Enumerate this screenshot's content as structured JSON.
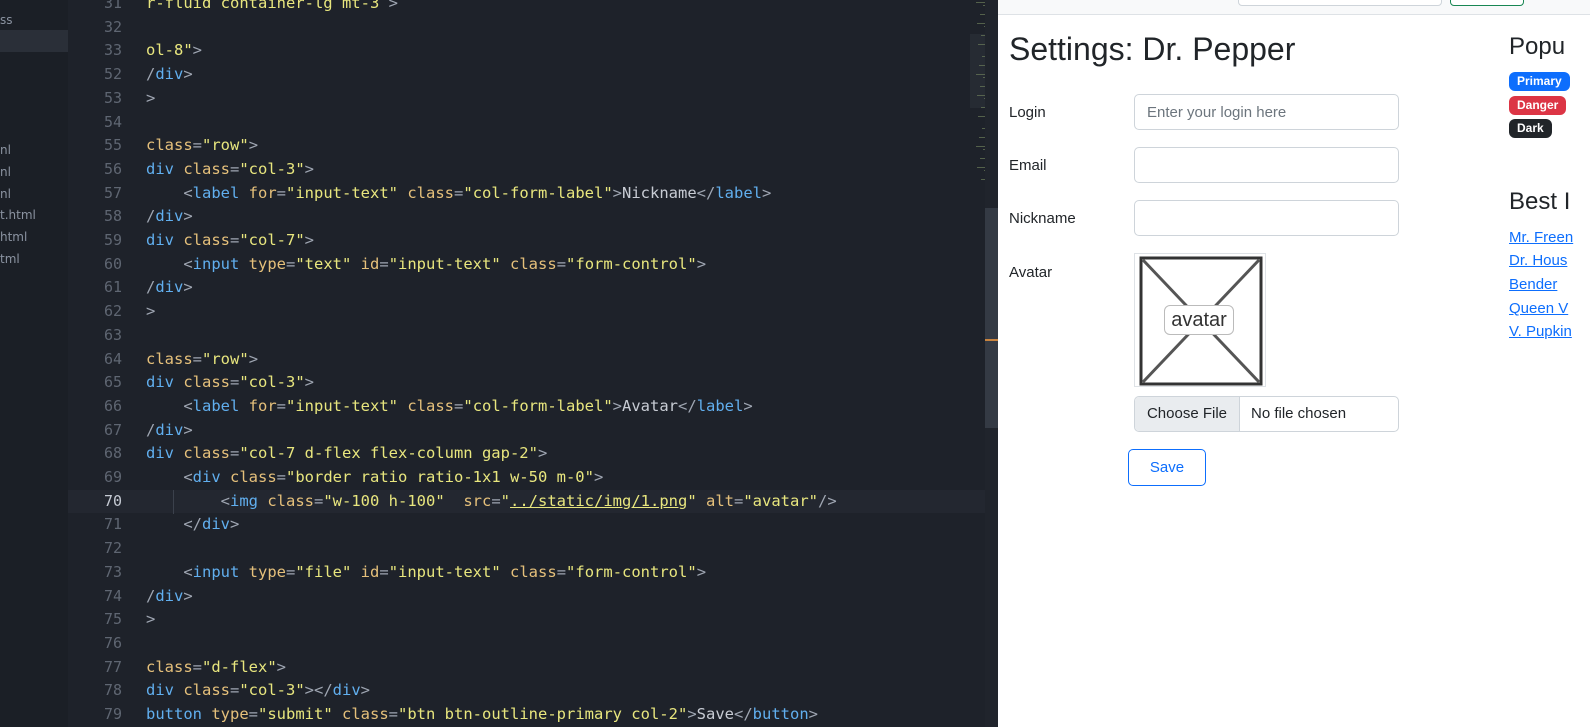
{
  "file_tree": {
    "items": [
      {
        "label": "ss"
      },
      {
        "label": "nl"
      },
      {
        "label": "nl"
      },
      {
        "label": "nl"
      },
      {
        "label": "t.html"
      },
      {
        "label": "html"
      },
      {
        "label": "tml"
      }
    ]
  },
  "editor": {
    "lines": [
      {
        "num": "31",
        "tokens": [
          {
            "t": "str",
            "v": "r-fluid container-lg mt-3"
          },
          {
            "t": "punct",
            "v": " >"
          }
        ]
      },
      {
        "num": "32",
        "tokens": []
      },
      {
        "num": "33",
        "tokens": [
          {
            "t": "str",
            "v": "ol-8\""
          },
          {
            "t": "punct",
            "v": ">"
          }
        ]
      },
      {
        "num": "52",
        "tokens": [
          {
            "t": "punct",
            "v": "/"
          },
          {
            "t": "tag",
            "v": "div"
          },
          {
            "t": "punct",
            "v": ">"
          }
        ]
      },
      {
        "num": "53",
        "tokens": [
          {
            "t": "punct",
            "v": ">"
          }
        ]
      },
      {
        "num": "54",
        "tokens": []
      },
      {
        "num": "55",
        "tokens": [
          {
            "t": "attr",
            "v": "class"
          },
          {
            "t": "punct",
            "v": "="
          },
          {
            "t": "str",
            "v": "\"row\""
          },
          {
            "t": "punct",
            "v": ">"
          }
        ]
      },
      {
        "num": "56",
        "tokens": [
          {
            "t": "tag",
            "v": "div "
          },
          {
            "t": "attr",
            "v": "class"
          },
          {
            "t": "punct",
            "v": "="
          },
          {
            "t": "str",
            "v": "\"col-3\""
          },
          {
            "t": "punct",
            "v": ">"
          }
        ]
      },
      {
        "num": "57",
        "tokens": [
          {
            "t": "text",
            "v": "    "
          },
          {
            "t": "punct",
            "v": "<"
          },
          {
            "t": "tag",
            "v": "label "
          },
          {
            "t": "attr",
            "v": "for"
          },
          {
            "t": "punct",
            "v": "="
          },
          {
            "t": "str",
            "v": "\"input-text\" "
          },
          {
            "t": "attr",
            "v": "class"
          },
          {
            "t": "punct",
            "v": "="
          },
          {
            "t": "str",
            "v": "\"col-form-label\""
          },
          {
            "t": "punct",
            "v": ">"
          },
          {
            "t": "text",
            "v": "Nickname"
          },
          {
            "t": "punct",
            "v": "</"
          },
          {
            "t": "tag",
            "v": "label"
          },
          {
            "t": "punct",
            "v": ">"
          }
        ]
      },
      {
        "num": "58",
        "tokens": [
          {
            "t": "punct",
            "v": "/"
          },
          {
            "t": "tag",
            "v": "div"
          },
          {
            "t": "punct",
            "v": ">"
          }
        ]
      },
      {
        "num": "59",
        "tokens": [
          {
            "t": "tag",
            "v": "div "
          },
          {
            "t": "attr",
            "v": "class"
          },
          {
            "t": "punct",
            "v": "="
          },
          {
            "t": "str",
            "v": "\"col-7\""
          },
          {
            "t": "punct",
            "v": ">"
          }
        ]
      },
      {
        "num": "60",
        "tokens": [
          {
            "t": "text",
            "v": "    "
          },
          {
            "t": "punct",
            "v": "<"
          },
          {
            "t": "tag",
            "v": "input "
          },
          {
            "t": "attr",
            "v": "type"
          },
          {
            "t": "punct",
            "v": "="
          },
          {
            "t": "str",
            "v": "\"text\" "
          },
          {
            "t": "attr",
            "v": "id"
          },
          {
            "t": "punct",
            "v": "="
          },
          {
            "t": "str",
            "v": "\"input-text\" "
          },
          {
            "t": "attr",
            "v": "class"
          },
          {
            "t": "punct",
            "v": "="
          },
          {
            "t": "str",
            "v": "\"form-control\""
          },
          {
            "t": "punct",
            "v": ">"
          }
        ]
      },
      {
        "num": "61",
        "tokens": [
          {
            "t": "punct",
            "v": "/"
          },
          {
            "t": "tag",
            "v": "div"
          },
          {
            "t": "punct",
            "v": ">"
          }
        ]
      },
      {
        "num": "62",
        "tokens": [
          {
            "t": "punct",
            "v": ">"
          }
        ]
      },
      {
        "num": "63",
        "tokens": []
      },
      {
        "num": "64",
        "tokens": [
          {
            "t": "attr",
            "v": "class"
          },
          {
            "t": "punct",
            "v": "="
          },
          {
            "t": "str",
            "v": "\"row\""
          },
          {
            "t": "punct",
            "v": ">"
          }
        ]
      },
      {
        "num": "65",
        "tokens": [
          {
            "t": "tag",
            "v": "div "
          },
          {
            "t": "attr",
            "v": "class"
          },
          {
            "t": "punct",
            "v": "="
          },
          {
            "t": "str",
            "v": "\"col-3\""
          },
          {
            "t": "punct",
            "v": ">"
          }
        ]
      },
      {
        "num": "66",
        "tokens": [
          {
            "t": "text",
            "v": "    "
          },
          {
            "t": "punct",
            "v": "<"
          },
          {
            "t": "tag",
            "v": "label "
          },
          {
            "t": "attr",
            "v": "for"
          },
          {
            "t": "punct",
            "v": "="
          },
          {
            "t": "str",
            "v": "\"input-text\" "
          },
          {
            "t": "attr",
            "v": "class"
          },
          {
            "t": "punct",
            "v": "="
          },
          {
            "t": "str",
            "v": "\"col-form-label\""
          },
          {
            "t": "punct",
            "v": ">"
          },
          {
            "t": "text",
            "v": "Avatar"
          },
          {
            "t": "punct",
            "v": "</"
          },
          {
            "t": "tag",
            "v": "label"
          },
          {
            "t": "punct",
            "v": ">"
          }
        ]
      },
      {
        "num": "67",
        "tokens": [
          {
            "t": "punct",
            "v": "/"
          },
          {
            "t": "tag",
            "v": "div"
          },
          {
            "t": "punct",
            "v": ">"
          }
        ]
      },
      {
        "num": "68",
        "tokens": [
          {
            "t": "tag",
            "v": "div "
          },
          {
            "t": "attr",
            "v": "class"
          },
          {
            "t": "punct",
            "v": "="
          },
          {
            "t": "str",
            "v": "\"col-7 d-flex flex-column gap-2\""
          },
          {
            "t": "punct",
            "v": ">"
          }
        ]
      },
      {
        "num": "69",
        "tokens": [
          {
            "t": "text",
            "v": "    "
          },
          {
            "t": "punct",
            "v": "<"
          },
          {
            "t": "tag",
            "v": "div "
          },
          {
            "t": "attr",
            "v": "class"
          },
          {
            "t": "punct",
            "v": "="
          },
          {
            "t": "str",
            "v": "\"border ratio ratio-1x1 w-50 m-0\""
          },
          {
            "t": "punct",
            "v": ">"
          }
        ]
      },
      {
        "num": "70",
        "current": true,
        "tokens": [
          {
            "t": "text",
            "v": "        "
          },
          {
            "t": "punct",
            "v": "<"
          },
          {
            "t": "tag",
            "v": "img "
          },
          {
            "t": "attr",
            "v": "class"
          },
          {
            "t": "punct",
            "v": "="
          },
          {
            "t": "str",
            "v": "\"w-100 h-100\"  "
          },
          {
            "t": "attr",
            "v": "src"
          },
          {
            "t": "punct",
            "v": "="
          },
          {
            "t": "str",
            "v": "\""
          },
          {
            "t": "str-link",
            "v": "../static/img/1.png"
          },
          {
            "t": "str",
            "v": "\" "
          },
          {
            "t": "attr",
            "v": "alt"
          },
          {
            "t": "punct",
            "v": "="
          },
          {
            "t": "str",
            "v": "\"avatar\""
          },
          {
            "t": "punct",
            "v": "/>"
          }
        ]
      },
      {
        "num": "71",
        "tokens": [
          {
            "t": "text",
            "v": "    "
          },
          {
            "t": "punct",
            "v": "</"
          },
          {
            "t": "tag",
            "v": "div"
          },
          {
            "t": "punct",
            "v": ">"
          }
        ]
      },
      {
        "num": "72",
        "tokens": []
      },
      {
        "num": "73",
        "tokens": [
          {
            "t": "text",
            "v": "    "
          },
          {
            "t": "punct",
            "v": "<"
          },
          {
            "t": "tag",
            "v": "input "
          },
          {
            "t": "attr",
            "v": "type"
          },
          {
            "t": "punct",
            "v": "="
          },
          {
            "t": "str",
            "v": "\"file\" "
          },
          {
            "t": "attr",
            "v": "id"
          },
          {
            "t": "punct",
            "v": "="
          },
          {
            "t": "str",
            "v": "\"input-text\" "
          },
          {
            "t": "attr",
            "v": "class"
          },
          {
            "t": "punct",
            "v": "="
          },
          {
            "t": "str",
            "v": "\"form-control\""
          },
          {
            "t": "punct",
            "v": ">"
          }
        ]
      },
      {
        "num": "74",
        "tokens": [
          {
            "t": "punct",
            "v": "/"
          },
          {
            "t": "tag",
            "v": "div"
          },
          {
            "t": "punct",
            "v": ">"
          }
        ]
      },
      {
        "num": "75",
        "tokens": [
          {
            "t": "punct",
            "v": ">"
          }
        ]
      },
      {
        "num": "76",
        "tokens": []
      },
      {
        "num": "77",
        "tokens": [
          {
            "t": "attr",
            "v": "class"
          },
          {
            "t": "punct",
            "v": "="
          },
          {
            "t": "str",
            "v": "\"d-flex\""
          },
          {
            "t": "punct",
            "v": ">"
          }
        ]
      },
      {
        "num": "78",
        "tokens": [
          {
            "t": "tag",
            "v": "div "
          },
          {
            "t": "attr",
            "v": "class"
          },
          {
            "t": "punct",
            "v": "="
          },
          {
            "t": "str",
            "v": "\"col-3\""
          },
          {
            "t": "punct",
            "v": "></"
          },
          {
            "t": "tag",
            "v": "div"
          },
          {
            "t": "punct",
            "v": ">"
          }
        ]
      },
      {
        "num": "79",
        "tokens": [
          {
            "t": "tag",
            "v": "button "
          },
          {
            "t": "attr",
            "v": "type"
          },
          {
            "t": "punct",
            "v": "="
          },
          {
            "t": "str",
            "v": "\"submit\" "
          },
          {
            "t": "attr",
            "v": "class"
          },
          {
            "t": "punct",
            "v": "="
          },
          {
            "t": "str",
            "v": "\"btn btn-outline-primary col-2\""
          },
          {
            "t": "punct",
            "v": ">"
          },
          {
            "t": "text",
            "v": "Save"
          },
          {
            "t": "punct",
            "v": "</"
          },
          {
            "t": "tag",
            "v": "button"
          },
          {
            "t": "punct",
            "v": ">"
          }
        ]
      }
    ]
  },
  "preview": {
    "title": "Settings: Dr. Pepper",
    "form": {
      "login_label": "Login",
      "login_placeholder": "Enter your login here",
      "email_label": "Email",
      "nickname_label": "Nickname",
      "avatar_label": "Avatar",
      "avatar_alt": "avatar",
      "choose_file_label": "Choose File",
      "file_status": "No file chosen",
      "save_label": "Save"
    },
    "sidebar": {
      "popular_heading": "Popu",
      "badges": [
        {
          "label": "Primary",
          "color": "#0d6efd"
        },
        {
          "label": "Danger",
          "color": "#dc3545"
        },
        {
          "label": "Dark",
          "color": "#212529"
        }
      ],
      "best_heading": "Best I",
      "links": [
        "Mr. Freen",
        "Dr. Hous",
        "Bender",
        "Queen V",
        "V. Pupkin"
      ]
    }
  },
  "colors": {
    "editor_bg": "#1e222a",
    "tag": "#61afef",
    "attr": "#e5c07b",
    "string": "#e8e67e",
    "accent_primary": "#0d6efd"
  }
}
